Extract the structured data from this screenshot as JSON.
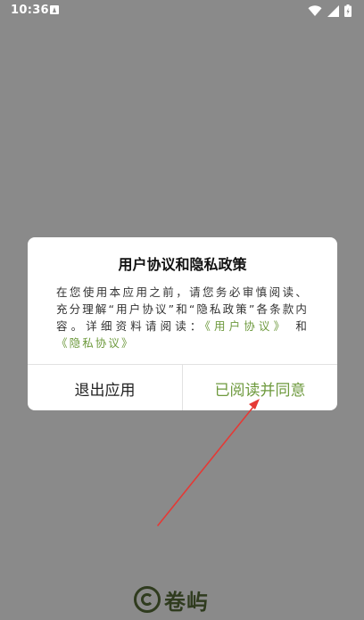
{
  "status_bar": {
    "time": "10:36",
    "icons": [
      "notification-a-icon",
      "wifi-icon",
      "signal-icon",
      "battery-icon"
    ]
  },
  "dialog": {
    "title": "用户协议和隐私政策",
    "body_text": "在您使用本应用之前，请您务必审慎阅读、充分理解“用户协议”和“隐私政策”各条款内容。详细资料请阅读：",
    "link_user_agreement": "《用户协议》",
    "and_text": " 和 ",
    "link_privacy_policy": "《隐私协议》",
    "exit_label": "退出应用",
    "agree_label": "已阅读并同意"
  },
  "brand": {
    "name": "卷屿"
  },
  "colors": {
    "overlay": "#8a8a8a",
    "accent": "#6e9a3e",
    "annotation_arrow": "#e53935",
    "brand": "#2f3b1e"
  }
}
